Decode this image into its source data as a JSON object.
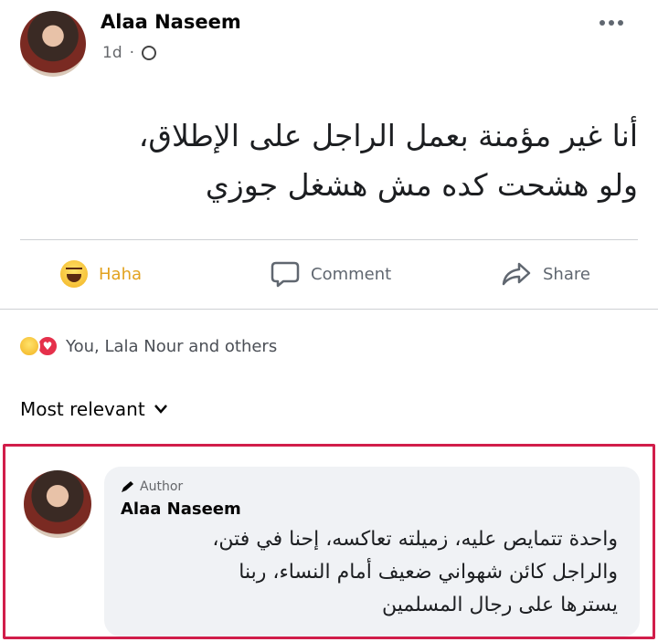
{
  "post": {
    "author": "Alaa Naseem",
    "time": "1d",
    "separator": "·",
    "privacy_icon": "globe-icon",
    "text_lines": [
      "أنا غير مؤمنة بعمل الراجل على الإطلاق،",
      "ولو هشحت كده مش هشغل جوزي"
    ]
  },
  "actions": {
    "reaction_label": "Haha",
    "comment_label": "Comment",
    "share_label": "Share"
  },
  "reactions": {
    "icons": [
      "haha-icon",
      "love-icon"
    ],
    "summary": "You, Lala Nour and others"
  },
  "comments": {
    "sort_label": "Most relevant",
    "items": [
      {
        "badge": "Author",
        "name": "Alaa Naseem",
        "text_lines": [
          "واحدة تتمايص عليه، زميلته تعاكسه، إحنا في فتن،",
          "والراجل كائن شهواني ضعيف أمام النساء، ربنا",
          "يسترها على رجال المسلمين"
        ]
      }
    ]
  },
  "colors": {
    "haha": "#e2a21f",
    "love": "#e5304b",
    "highlight_border": "#d11d4a",
    "bubble": "#f0f2f5"
  }
}
